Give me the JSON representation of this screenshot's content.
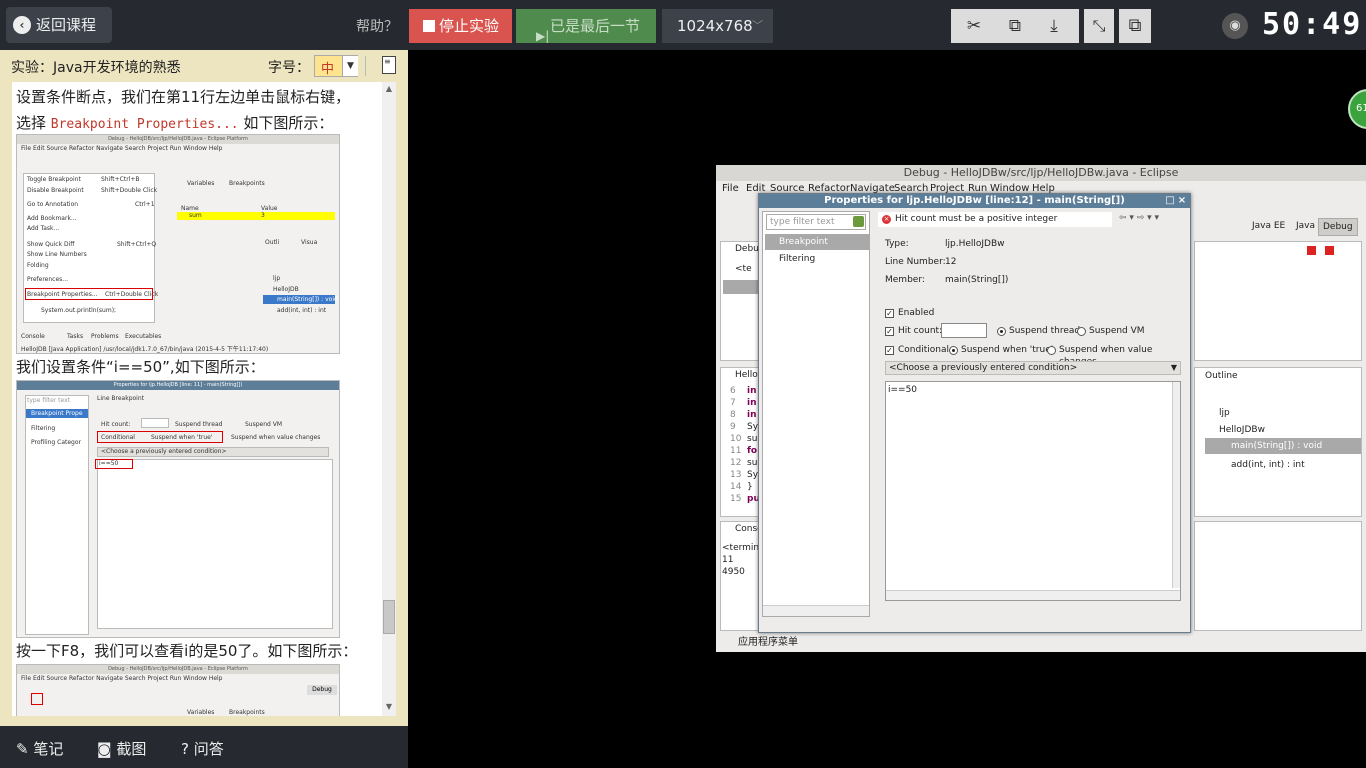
{
  "topbar": {
    "back_label": "返回课程",
    "help_label": "帮助？",
    "stop_label": "停止实验",
    "last_label": "已是最后一节",
    "resolution": "1024x768",
    "timer": "50:49"
  },
  "left_panel": {
    "title": "实验：Java开发环境的熟悉",
    "font_label": "字号：",
    "font_value": "中",
    "para1_a": "设置条件断点，我们在第11行左边单击鼠标右键，",
    "para1_b_pre": "选择 ",
    "para1_b_code": "Breakpoint Properties...",
    "para1_b_post": " 如下图所示：",
    "para2": "我们设置条件“i==50”,如下图所示：",
    "para3": "按一下F8，我们可以查看i的是50了。如下图所示：",
    "shot1": {
      "title": "Debug - HelloJDB/src/ljp/HelloJDB.java - Eclipse Platform",
      "menu": "File  Edit  Source  Refactor  Navigate  Search  Project  Run  Window  Help",
      "items": [
        "Toggle Breakpoint",
        "Disable Breakpoint",
        "Go to Annotation",
        "Add Bookmark...",
        "Add Task...",
        "Show Quick Diff",
        "Show Line Numbers",
        "Folding",
        "Preferences...",
        "Breakpoint Properties..."
      ],
      "shortcuts": [
        "Shift+Ctrl+B",
        "Shift+Double Click",
        "Ctrl+1",
        "",
        "",
        "Shift+Ctrl+Q",
        "",
        "",
        "",
        "Ctrl+Double Click"
      ],
      "tabs": [
        "Variables",
        "Breakpoints"
      ],
      "var_header": [
        "Name",
        "Value"
      ],
      "var_row": [
        "sum",
        "3"
      ],
      "outline_tabs": [
        "Outli",
        "Visua"
      ],
      "outline": [
        "ljp",
        "HelloJDB",
        "main(String[]) : void",
        "add(int, int) : int"
      ],
      "code": "System.out.println(sum);",
      "console_tabs": [
        "Console",
        "Tasks",
        "Problems",
        "Executables"
      ],
      "console_line": "HelloJDB [Java Application] /usr/local/jdk1.7.0_67/bin/java (2015-4-5 下午11:17:40)"
    },
    "shot2": {
      "title": "Properties for ljp.HelloJDB [line: 11] - main(String[])",
      "filter": "type filter text",
      "items": [
        "Breakpoint Prope",
        "Filtering",
        "Profiling Categor"
      ],
      "heading": "Line Breakpoint",
      "hit": "Hit count:",
      "suspend_thread": "Suspend thread",
      "suspend_vm": "Suspend VM",
      "conditional": "Conditional",
      "when_true": "Suspend when 'true'",
      "when_changes": "Suspend when value changes",
      "choose": "<Choose a previously entered condition>",
      "cond": "i==50"
    },
    "shot3": {
      "title": "Debug - HelloJDB/src/ljp/HelloJDB.java - Eclipse Platform",
      "menu": "File  Edit  Source  Refactor  Navigate  Search  Project  Run  Window  Help",
      "debug_tab": "Debug",
      "tabs": [
        "Variables",
        "Breakpoints"
      ]
    }
  },
  "bottombar": {
    "notes": "笔记",
    "screenshot": "截图",
    "qa": "问答"
  },
  "remote": {
    "window_title": "Debug - HelloJDBw/src/ljp/HelloJDBw.java - Eclipse",
    "menu": [
      "File",
      "Edit",
      "Source",
      "Refactor",
      "Navigate",
      "Search",
      "Project",
      "Run",
      "Window",
      "Help"
    ],
    "perspectives": [
      "Java EE",
      "Java",
      "Debug"
    ],
    "debug_tab": "Debu",
    "tree_node": "<te",
    "editor_tab": "Hello",
    "line_numbers": [
      "6",
      "7",
      "8",
      "9",
      "10",
      "11",
      "12",
      "13",
      "14",
      "15"
    ],
    "code_frags": [
      "in",
      "in",
      "in",
      "Sy",
      "su",
      "fo",
      "su",
      "Sys",
      "}",
      "pu"
    ],
    "console_tab": "Conso",
    "console_lines": [
      "<termina",
      "11",
      "4950"
    ],
    "outline_tab": "Outline",
    "outline_items": [
      "ljp",
      "HelloJDBw",
      "main(String[]) : void",
      "add(int, int) : int"
    ],
    "status": "应用程序菜单"
  },
  "dialog": {
    "title": "Properties for ljp.HelloJDBw [line:12] - main(String[])",
    "filter_placeholder": "type filter text",
    "nav_items": [
      "Breakpoint Properties",
      "Filtering"
    ],
    "message": "Hit count must be a positive integer",
    "type_label": "Type:",
    "type_value": "ljp.HelloJDBw",
    "line_label": "Line Number:",
    "line_value": "12",
    "member_label": "Member:",
    "member_value": "main(String[])",
    "enabled": "Enabled",
    "hit_count": "Hit count:",
    "suspend_thread": "Suspend thread",
    "suspend_vm": "Suspend VM",
    "conditional": "Conditional",
    "when_true": "Suspend when 'true'",
    "when_changes": "Suspend when value changes",
    "choose": "<Choose a previously entered condition>",
    "condition": "i==50"
  },
  "badge": "61"
}
